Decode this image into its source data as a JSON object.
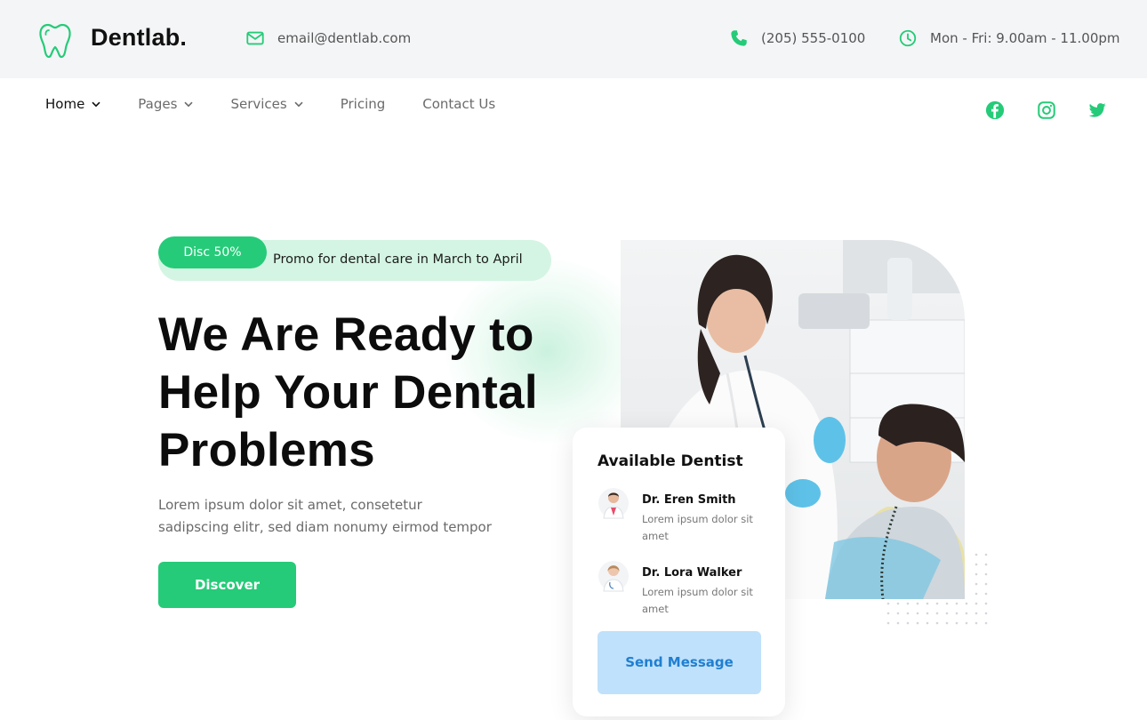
{
  "brand": {
    "name": "Dentlab.",
    "accent": "#25cb78",
    "logo_icon": "tooth-icon"
  },
  "topbar": {
    "email": "email@dentlab.com",
    "phone": "(205) 555-0100",
    "hours": "Mon - Fri: 9.00am - 11.00pm",
    "email_icon": "mail-icon",
    "phone_icon": "phone-icon",
    "hours_icon": "clock-icon"
  },
  "nav": {
    "items": [
      {
        "label": "Home",
        "active": true,
        "dropdown": true
      },
      {
        "label": "Pages",
        "active": false,
        "dropdown": true
      },
      {
        "label": "Services",
        "active": false,
        "dropdown": true
      },
      {
        "label": "Pricing",
        "active": false,
        "dropdown": false
      },
      {
        "label": "Contact Us",
        "active": false,
        "dropdown": false
      }
    ],
    "social": [
      "facebook-icon",
      "instagram-icon",
      "twitter-icon"
    ]
  },
  "hero": {
    "promo_badge": "Disc 50%",
    "promo_text": "Promo for dental care in March to April",
    "headline": [
      "We Are Ready to",
      "Help Your Dental",
      "Problems"
    ],
    "subtext": "Lorem ipsum dolor sit amet, consetetur sadipscing elitr, sed diam nonumy eirmod tempor",
    "cta": "Discover"
  },
  "card": {
    "title": "Available Dentist",
    "dentists": [
      {
        "name": "Dr. Eren Smith",
        "desc": "Lorem ipsum dolor sit amet"
      },
      {
        "name": "Dr. Lora Walker",
        "desc": "Lorem ipsum dolor sit amet"
      }
    ],
    "button": "Send Message"
  },
  "colors": {
    "accent": "#25cb78",
    "promo_bg": "#d4f5e3",
    "send_bg": "#bfe1fb",
    "send_text": "#1f7fd1",
    "topbar_bg": "#f4f5f7"
  }
}
